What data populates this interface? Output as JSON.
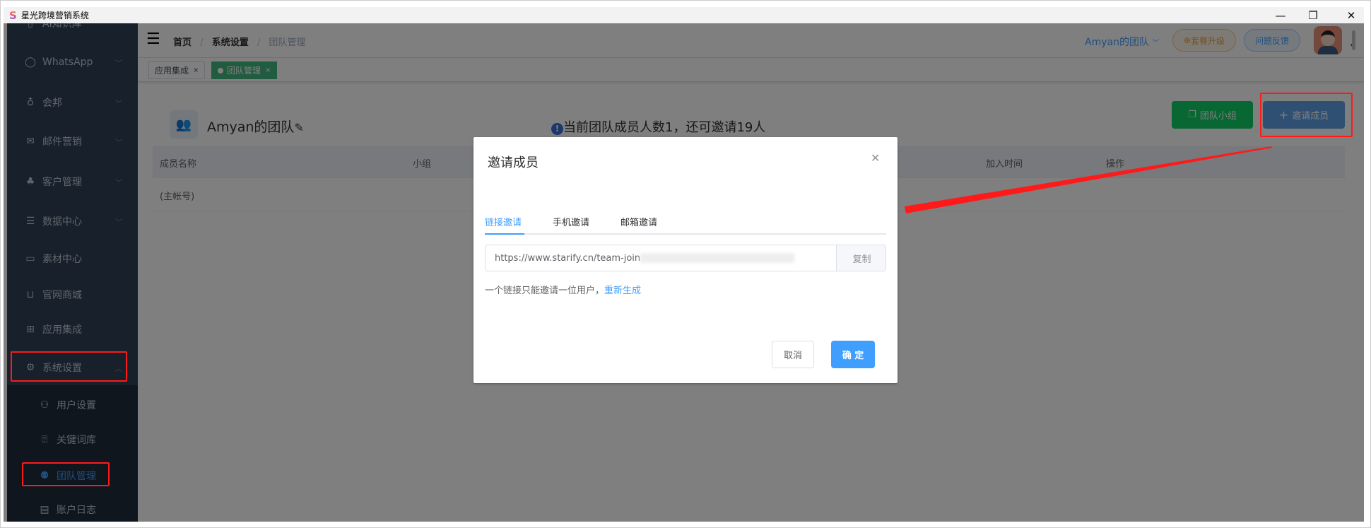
{
  "window": {
    "title": "星光跨境营销系统",
    "logo": "S",
    "min_icon": "minimize-icon",
    "restore_icon": "restore-icon",
    "close_icon": "close-icon"
  },
  "sidebar": {
    "items": [
      {
        "label": "AI知识库",
        "icon": "book-icon",
        "chevron": true
      },
      {
        "label": "WhatsApp",
        "icon": "whatsapp-icon",
        "chevron": true
      },
      {
        "label": "会邦",
        "icon": "lightbulb-icon",
        "chevron": true
      },
      {
        "label": "邮件营销",
        "icon": "mail-icon",
        "chevron": true
      },
      {
        "label": "客户管理",
        "icon": "customers-icon",
        "chevron": true
      },
      {
        "label": "数据中心",
        "icon": "database-icon",
        "chevron": true
      },
      {
        "label": "素材中心",
        "icon": "folder-icon",
        "chevron": false
      },
      {
        "label": "官网商城",
        "icon": "cart-icon",
        "chevron": false
      },
      {
        "label": "应用集成",
        "icon": "apps-icon",
        "chevron": false
      },
      {
        "label": "系统设置",
        "icon": "gear-icon",
        "chevron": true,
        "expanded": true
      }
    ],
    "subitems": [
      {
        "label": "用户设置",
        "icon": "user-settings-icon"
      },
      {
        "label": "关键词库",
        "icon": "keyword-icon"
      },
      {
        "label": "团队管理",
        "icon": "team-icon",
        "active": true
      },
      {
        "label": "账户日志",
        "icon": "log-icon"
      }
    ]
  },
  "header": {
    "breadcrumb": [
      "首页",
      "系统设置",
      "团队管理"
    ],
    "team_select": "Amyan的团队",
    "upgrade": "套餐升级",
    "feedback": "问题反馈"
  },
  "tags": [
    {
      "label": "应用集成",
      "active": false
    },
    {
      "label": "团队管理",
      "active": true
    }
  ],
  "main": {
    "team_name": "Amyan的团队",
    "notice": "当前团队成员人数1，还可邀请19人",
    "group_button": "团队小组",
    "invite_button": "邀请成员",
    "table": {
      "columns": [
        "成员名称",
        "小组",
        "加入时间",
        "操作"
      ],
      "rows": [
        [
          "(主帐号)",
          "",
          "",
          ""
        ]
      ]
    }
  },
  "dialog": {
    "title": "邀请成员",
    "tabs": [
      "链接邀请",
      "手机邀请",
      "邮箱邀请"
    ],
    "active_tab": 0,
    "link_value": "https://www.starify.cn/team-join",
    "copy": "复制",
    "hint": "一个链接只能邀请一位用户，",
    "regenerate": "重新生成",
    "cancel": "取消",
    "confirm": "确 定"
  },
  "colors": {
    "primary": "#409eff",
    "success": "#13ce66",
    "sidebar": "#304156",
    "annotation": "#ff1a1a"
  }
}
